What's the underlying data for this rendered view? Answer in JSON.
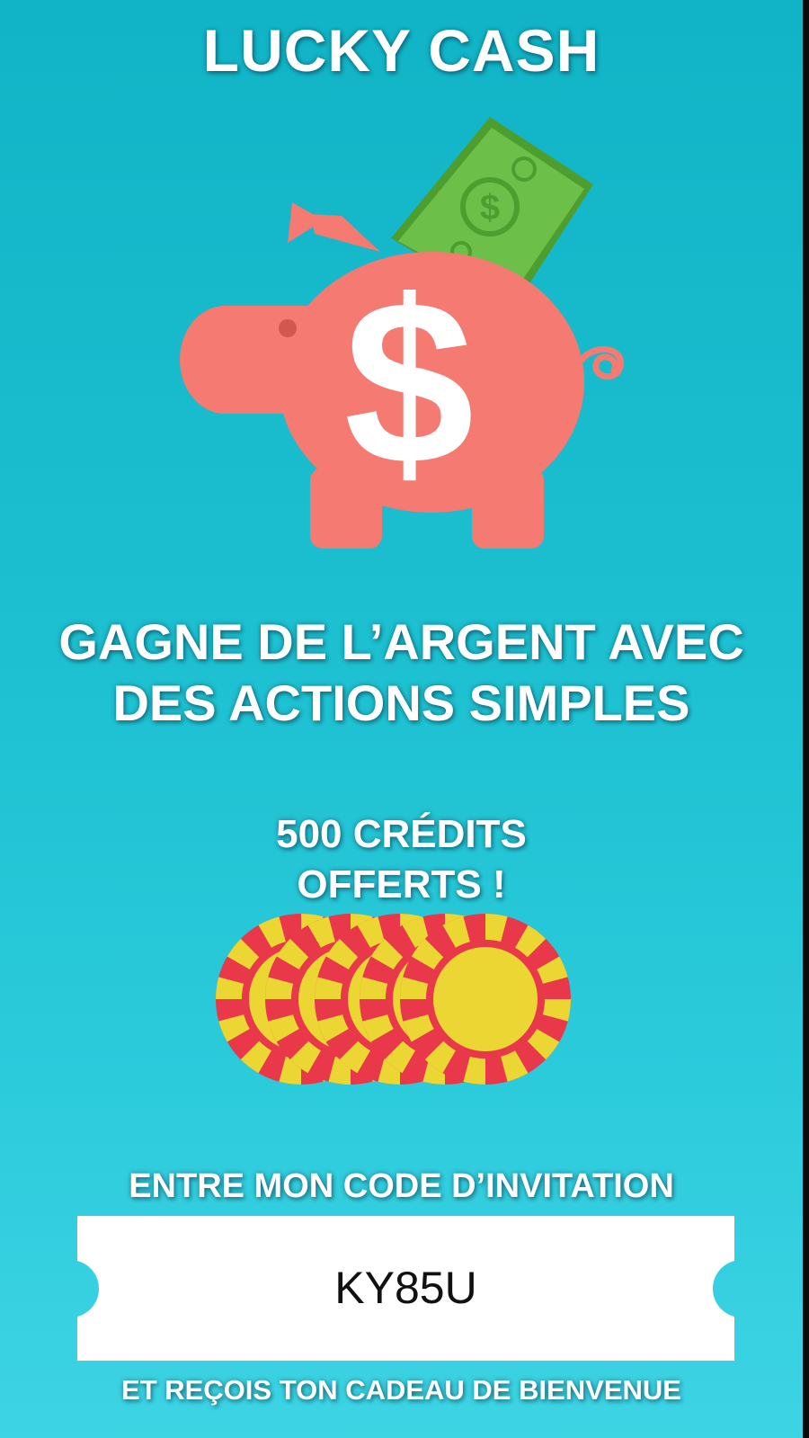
{
  "app": {
    "title": "LUCKY CASH"
  },
  "hero": {
    "headline_line1": "GAGNE DE L’ARGENT AVEC",
    "headline_line2": "DES ACTIONS SIMPLES"
  },
  "promo": {
    "credits_line1": "500 CRÉDITS",
    "credits_line2": "OFFERTS !"
  },
  "invite": {
    "label": "ENTRE MON CODE D’INVITATION",
    "code_value": "KY85U",
    "footer": "ET REÇOIS TON CADEAU DE BIENVENUE"
  },
  "icons": {
    "piggy": "piggy-bank-dollar-icon",
    "chips": "casino-chips-icon"
  },
  "colors": {
    "bg_top": "#10b4c6",
    "bg_bottom": "#3dd4e4",
    "piggy": "#f47a72",
    "banknote": "#6cc04a",
    "chip_red": "#e8384a",
    "chip_yellow": "#ecd634",
    "text": "#ffffff"
  }
}
